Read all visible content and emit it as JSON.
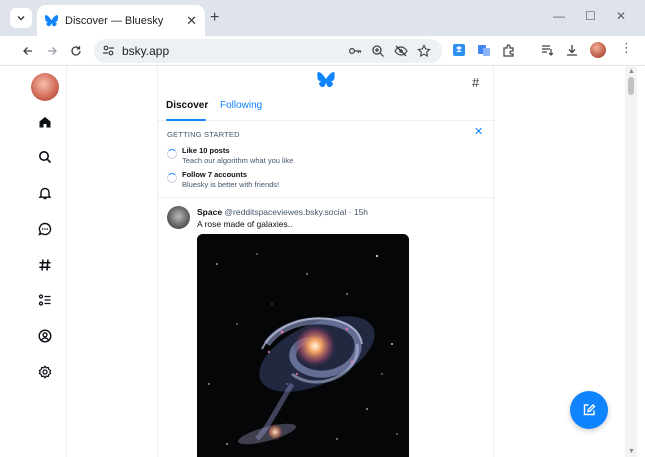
{
  "browser": {
    "tab_title": "Discover — Bluesky",
    "url": "bsky.app",
    "new_tab_label": "+",
    "tab_close_label": "✕",
    "minimize_label": "—",
    "maximize_label": "☐",
    "close_label": "✕",
    "menu_label": "⋮"
  },
  "feed": {
    "hash_label": "#",
    "tabs": [
      {
        "label": "Discover",
        "active": true
      },
      {
        "label": "Following",
        "active": false
      }
    ]
  },
  "getting_started": {
    "title": "GETTING STARTED",
    "close_label": "✕",
    "items": [
      {
        "title": "Like 10 posts",
        "subtitle": "Teach our algorithm what you like"
      },
      {
        "title": "Follow 7 accounts",
        "subtitle": "Bluesky is better with friends!"
      }
    ]
  },
  "post": {
    "author": "Space",
    "handle": "@redditspaceviewes.bsky.social",
    "time": "· 15h",
    "text": "A rose made of galaxies.."
  },
  "colors": {
    "accent": "#1083fe",
    "tabstrip": "#dfe3eb",
    "muted_text": "#42576c"
  },
  "icons": {
    "nav": [
      "home-icon",
      "search-icon",
      "bell-icon",
      "chat-icon",
      "hashtag-icon",
      "list-icon",
      "profile-icon",
      "settings-icon"
    ],
    "fab": "compose-icon"
  }
}
